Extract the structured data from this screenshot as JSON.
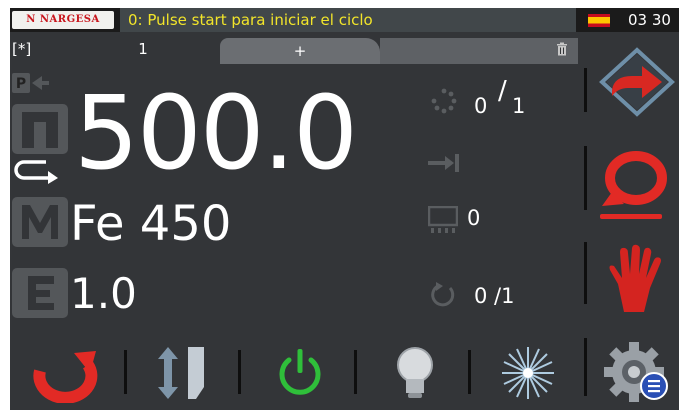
{
  "header": {
    "logo_text": "N NARGESA",
    "status_message": "0: Pulse start para iniciar el ciclo",
    "flag": "spain-flag",
    "time": "03 30"
  },
  "tabs": {
    "marker": "[*]",
    "active_label": "1",
    "add_label": "+"
  },
  "main": {
    "position_value": "500.0",
    "material": "Fe 450",
    "thickness": "1.0"
  },
  "counters": {
    "cycle_done": "0",
    "cycle_total": "1",
    "slash": "/",
    "pieces_value": "0",
    "repeat_text": "0 /1"
  },
  "sidebar": {
    "items": [
      {
        "icon": "next-arrow-icon"
      },
      {
        "icon": "cycle-mode-icon",
        "active": true
      },
      {
        "icon": "manual-hand-icon"
      },
      {
        "icon": "settings-gear-icon"
      }
    ]
  },
  "toolbar": {
    "items": [
      {
        "icon": "bend-rotate-icon"
      },
      {
        "icon": "clamp-up-down-icon"
      },
      {
        "icon": "power-icon"
      },
      {
        "icon": "light-bulb-icon"
      },
      {
        "icon": "laser-icon"
      }
    ]
  },
  "colors": {
    "background": "#333538",
    "status_text": "#f2e52a",
    "accent_red": "#e22a25",
    "power_green": "#2fbf3a"
  }
}
